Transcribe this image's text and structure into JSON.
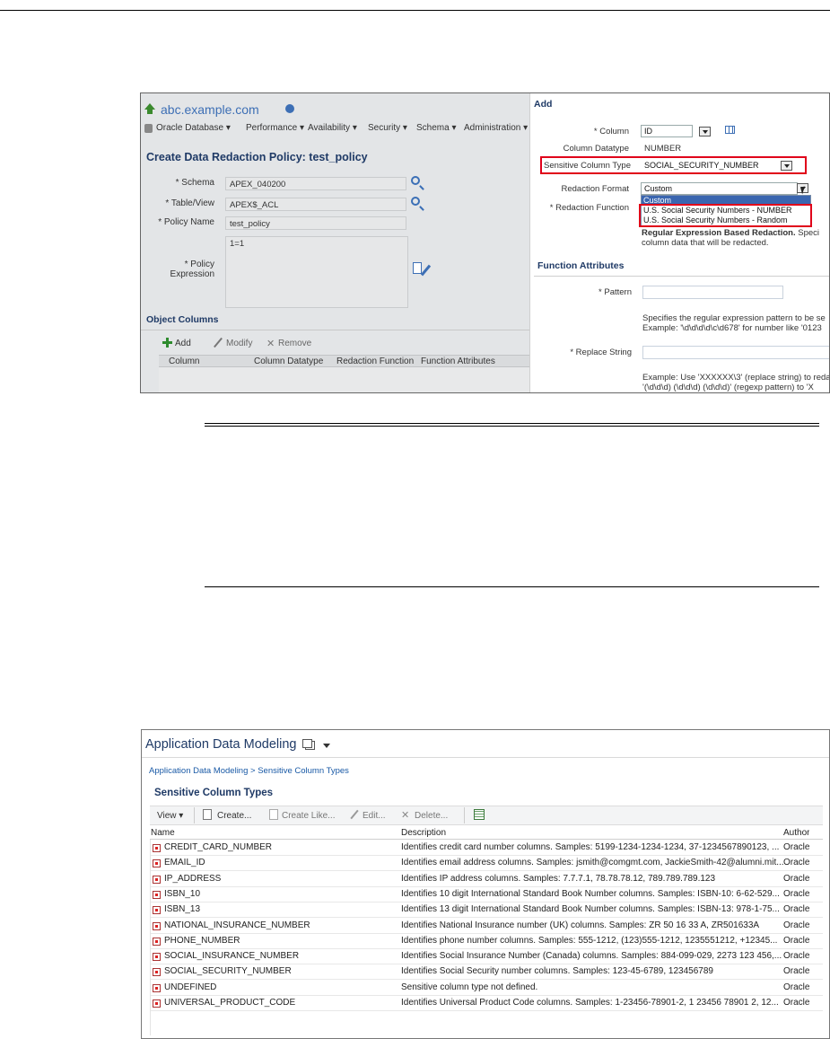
{
  "figure1": {
    "left": {
      "target_name": "abc.example.com",
      "menu": [
        "Oracle Database",
        "Performance",
        "Availability",
        "Security",
        "Schema",
        "Administration"
      ],
      "title": "Create Data Redaction Policy: test_policy",
      "schema_label": "* Schema",
      "schema_value": "APEX_040200",
      "table_label": "* Table/View",
      "table_value": "APEX$_ACL",
      "policy_label": "* Policy Name",
      "policy_value": "test_policy",
      "expr_label_1": "* Policy",
      "expr_label_2": "Expression",
      "expr_value": "1=1",
      "object_columns": "Object Columns",
      "add": "Add",
      "modify": "Modify",
      "remove": "Remove",
      "columns": [
        "Column",
        "Column Datatype",
        "Redaction Function",
        "Function Attributes"
      ]
    },
    "right": {
      "add_header": "Add",
      "column_label": "* Column",
      "column_value": "ID",
      "datatype_label": "Column Datatype",
      "datatype_value": "NUMBER",
      "sensitive_label": "Sensitive Column Type",
      "sensitive_value": "SOCIAL_SECURITY_NUMBER",
      "format_label": "Redaction Format",
      "format_value": "Custom",
      "format_options": [
        "Custom",
        "U.S. Social Security Numbers - NUMBER",
        "U.S. Social Security Numbers - Random"
      ],
      "function_label": "* Redaction Function",
      "regex_bold": "Regular Expression Based Redaction.",
      "regex_rest": " Speci",
      "regex_line2": "column data that will be redacted.",
      "func_attr_header": "Function Attributes",
      "pattern_label": "* Pattern",
      "pattern_help_1": "Specifies the regular expression pattern to be se",
      "pattern_help_2": "Example: '\\d\\d\\d\\d\\c\\d678' for number like '0123",
      "replace_label": "* Replace String",
      "replace_help_1": "Example: Use 'XXXXXX\\3' (replace string) to reda",
      "replace_help_2": "'(\\d\\d\\d) (\\d\\d\\d) (\\d\\d\\d)' (regexp pattern) to 'X"
    }
  },
  "figure2": {
    "title": "Application Data Modeling",
    "breadcrumb": "Application Data Modeling > Sensitive Column Types",
    "section_title": "Sensitive Column Types",
    "toolbar": {
      "view": "View",
      "create": "Create...",
      "create_like": "Create Like...",
      "edit": "Edit...",
      "delete": "Delete..."
    },
    "columns": [
      "Name",
      "Description",
      "Author"
    ],
    "rows": [
      {
        "name": "CREDIT_CARD_NUMBER",
        "desc": "Identifies credit card number columns. Samples: 5199-1234-1234-1234, 37-1234567890123, ...",
        "author": "Oracle"
      },
      {
        "name": "EMAIL_ID",
        "desc": "Identifies email address columns. Samples: jsmith@comgmt.com, JackieSmith-42@alumni.mit....",
        "author": "Oracle"
      },
      {
        "name": "IP_ADDRESS",
        "desc": "Identifies IP address columns. Samples: 7.7.7.1, 78.78.78.12, 789.789.789.123",
        "author": "Oracle"
      },
      {
        "name": "ISBN_10",
        "desc": "Identifies 10 digit International Standard Book Number columns. Samples: ISBN-10: 6-62-529...",
        "author": "Oracle"
      },
      {
        "name": "ISBN_13",
        "desc": "Identifies 13 digit International Standard Book Number columns. Samples: ISBN-13: 978-1-75...",
        "author": "Oracle"
      },
      {
        "name": "NATIONAL_INSURANCE_NUMBER",
        "desc": "Identifies National Insurance number (UK) columns. Samples: ZR 50 16 33 A, ZR501633A",
        "author": "Oracle"
      },
      {
        "name": "PHONE_NUMBER",
        "desc": "Identifies phone number columns. Samples: 555-1212, (123)555-1212, 1235551212, +12345...",
        "author": "Oracle"
      },
      {
        "name": "SOCIAL_INSURANCE_NUMBER",
        "desc": "Identifies Social Insurance Number (Canada) columns. Samples: 884-099-029, 2273 123 456,...",
        "author": "Oracle"
      },
      {
        "name": "SOCIAL_SECURITY_NUMBER",
        "desc": "Identifies Social Security number columns. Samples: 123-45-6789, 123456789",
        "author": "Oracle"
      },
      {
        "name": "UNDEFINED",
        "desc": "Sensitive column type not defined.",
        "author": "Oracle"
      },
      {
        "name": "UNIVERSAL_PRODUCT_CODE",
        "desc": "Identifies Universal Product Code columns. Samples: 1-23456-78901-2, 1 23456 78901 2, 12...",
        "author": "Oracle"
      }
    ]
  },
  "colors": {
    "accent": "#1f3a66",
    "highlight": "#e0001a",
    "link": "#1a5aa6"
  }
}
